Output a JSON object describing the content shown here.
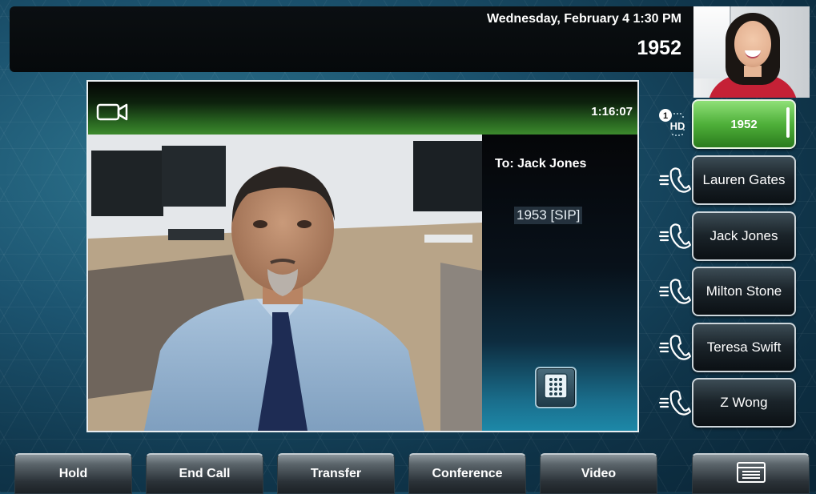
{
  "status": {
    "datetime": "Wednesday, February 4  1:30 PM",
    "extension": "1952"
  },
  "call": {
    "timer": "1:16:07",
    "to": "To: Jack Jones",
    "number": "1953 [SIP]"
  },
  "line_keys": [
    {
      "label": "1952",
      "active": true,
      "badge": "1",
      "badge_text": "HD"
    },
    {
      "label": "Lauren Gates"
    },
    {
      "label": "Jack Jones"
    },
    {
      "label": "Milton Stone"
    },
    {
      "label": "Teresa Swift"
    },
    {
      "label": "Z Wong"
    }
  ],
  "softkeys": {
    "hold": "Hold",
    "end_call": "End Call",
    "transfer": "Transfer",
    "conference": "Conference",
    "video": "Video"
  },
  "icons": {
    "camera": "video-camera-icon",
    "dialpad": "dialpad-icon",
    "phone": "handset-icon",
    "menu": "menu-list-icon"
  },
  "colors": {
    "active_line": "#4fb03a",
    "call_header": "#2b6b22",
    "background": "#1c5470"
  }
}
